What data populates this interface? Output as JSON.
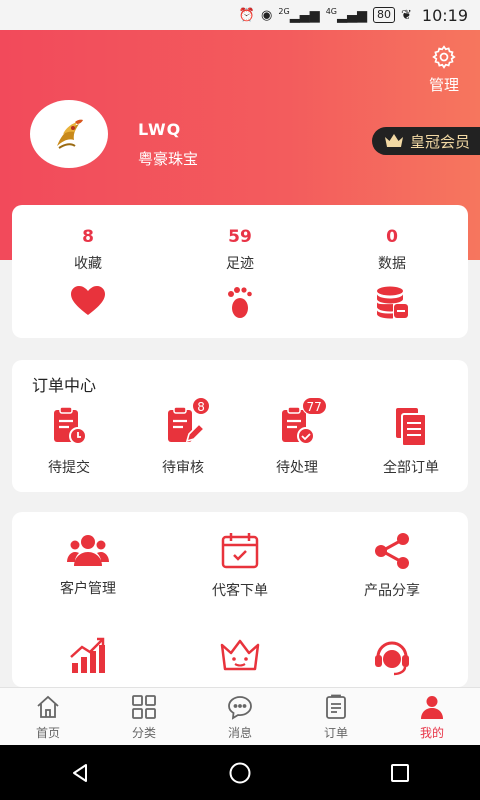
{
  "status_bar": {
    "network1": "2G",
    "network2": "4G",
    "battery": "80",
    "time": "10:19"
  },
  "header": {
    "manage_label": "管理",
    "username": "LWQ",
    "company": "粤豪珠宝",
    "member_badge": "皇冠会员"
  },
  "colors": {
    "accent": "#e83447",
    "hero_start": "#f24a5b",
    "hero_end": "#f6765e"
  },
  "stats": [
    {
      "value": "8",
      "label": "收藏",
      "icon": "heart-icon"
    },
    {
      "value": "59",
      "label": "足迹",
      "icon": "footprint-icon"
    },
    {
      "value": "0",
      "label": "数据",
      "icon": "database-icon"
    }
  ],
  "orders": {
    "title": "订单中心",
    "items": [
      {
        "label": "待提交",
        "icon": "clipboard-clock-icon",
        "badge": ""
      },
      {
        "label": "待审核",
        "icon": "clipboard-pen-icon",
        "badge": "8"
      },
      {
        "label": "待处理",
        "icon": "clipboard-check-icon",
        "badge": "77"
      },
      {
        "label": "全部订单",
        "icon": "documents-icon",
        "badge": ""
      }
    ]
  },
  "tools": [
    {
      "label": "客户管理",
      "icon": "customers-icon"
    },
    {
      "label": "代客下单",
      "icon": "calendar-check-icon"
    },
    {
      "label": "产品分享",
      "icon": "share-icon"
    },
    {
      "label": "",
      "icon": "bar-chart-icon"
    },
    {
      "label": "",
      "icon": "crown-face-icon"
    },
    {
      "label": "",
      "icon": "headset-icon"
    }
  ],
  "tabbar": [
    {
      "label": "首页",
      "icon": "home-icon"
    },
    {
      "label": "分类",
      "icon": "grid-icon"
    },
    {
      "label": "消息",
      "icon": "message-icon"
    },
    {
      "label": "订单",
      "icon": "order-list-icon"
    },
    {
      "label": "我的",
      "icon": "person-icon",
      "active": true
    }
  ]
}
